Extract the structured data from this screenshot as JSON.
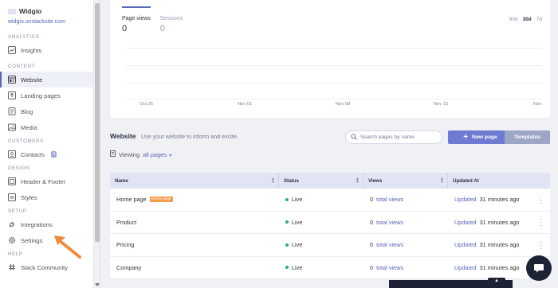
{
  "sidebar": {
    "brand": {
      "name": "Widgio",
      "url": "widgio.unstacksite.com"
    },
    "sections": {
      "analytics": "ANALYTICS",
      "content": "CONTENT",
      "customers": "CUSTOMERS",
      "design": "DESIGN",
      "setup": "SETUP",
      "help": "HELP"
    },
    "items": {
      "insights": "Insights",
      "website": "Website",
      "landing_pages": "Landing pages",
      "blog": "Blog",
      "media": "Media",
      "contacts": "Contacts",
      "contacts_count": "3",
      "header_footer": "Header & Footer",
      "styles": "Styles",
      "integrations": "Integrations",
      "settings": "Settings",
      "slack_community": "Slack Community"
    }
  },
  "analytics": {
    "metrics": [
      {
        "label": "Page views",
        "value": "0"
      },
      {
        "label": "Sessions",
        "value": "0"
      }
    ],
    "ranges": [
      "90d",
      "30d",
      "7d"
    ],
    "selected_range": "30d",
    "x_ticks": [
      "Oct 25",
      "Nov 01",
      "Nov 08",
      "Nov 15",
      "Nov"
    ]
  },
  "website": {
    "title": "Website",
    "subtitle": "Use your website to inform and excite.",
    "search_placeholder": "Search pages by name",
    "new_page_label": "New page",
    "templates_label": "Templates",
    "viewing_label": "Viewing",
    "viewing_filter": "all pages"
  },
  "table": {
    "headers": [
      "Name",
      "Status",
      "Views",
      "Updated At"
    ],
    "rows": [
      {
        "name": "Home page",
        "badge": "Home page",
        "status": "Live",
        "views_count": "0",
        "views_link": "total views",
        "updated_link": "Updated",
        "updated_time": "31 minutes ago"
      },
      {
        "name": "Product",
        "badge": "",
        "status": "Live",
        "views_count": "0",
        "views_link": "total views",
        "updated_link": "Updated",
        "updated_time": "31 minutes ago"
      },
      {
        "name": "Pricing",
        "badge": "",
        "status": "Live",
        "views_count": "0",
        "views_link": "total views",
        "updated_link": "Updated",
        "updated_time": "31 minutes ago"
      },
      {
        "name": "Company",
        "badge": "",
        "status": "Live",
        "views_count": "0",
        "views_link": "total views",
        "updated_link": "Updated",
        "updated_time": "31 minutes ago"
      }
    ]
  },
  "colors": {
    "accent": "#5865b8",
    "primary_button": "#6f7bd0",
    "badge_orange": "#f59b4c",
    "live_green": "#29b06b",
    "annotation_arrow": "#f08a3c"
  }
}
